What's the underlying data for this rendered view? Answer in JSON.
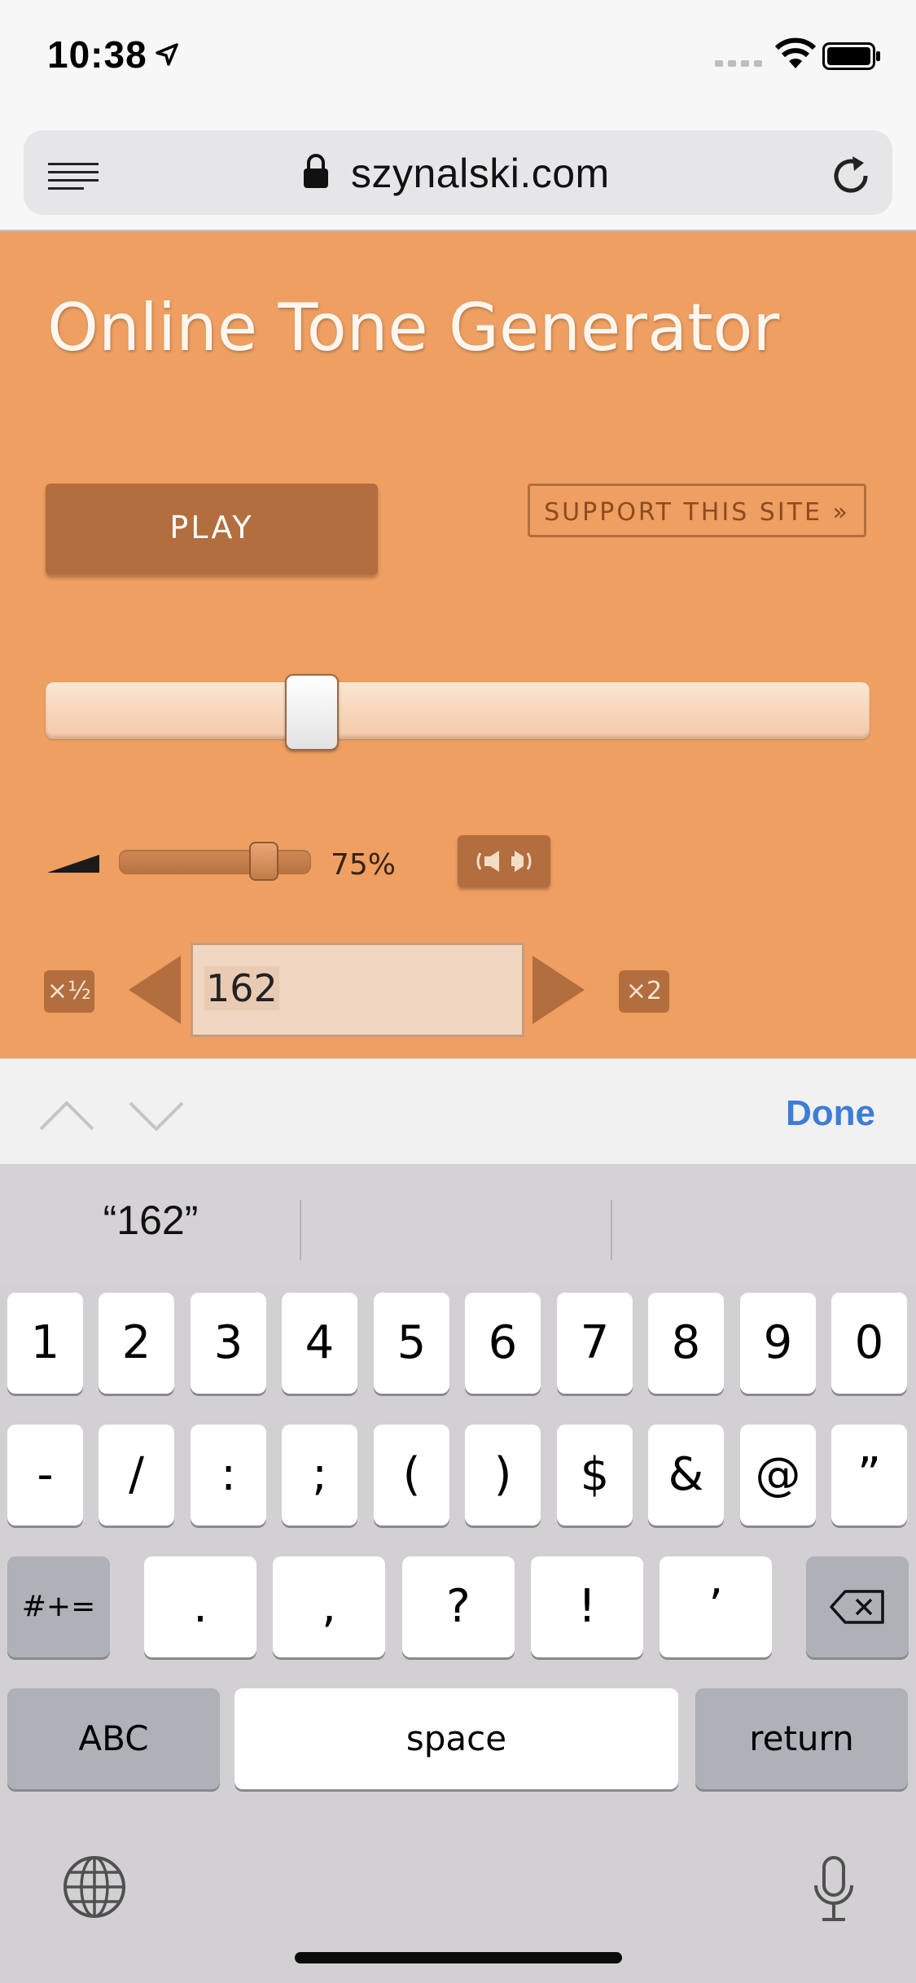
{
  "status_bar": {
    "time": "10:38"
  },
  "browser": {
    "url": "szynalski.com"
  },
  "page": {
    "title": "Online Tone Generator",
    "play_label": "PLAY",
    "support_label": "SUPPORT THIS SITE »",
    "volume_percent": 75,
    "volume_label": "75%",
    "half_label": "×½",
    "double_label": "×2",
    "frequency_value": "162"
  },
  "accessory": {
    "done_label": "Done"
  },
  "suggestions": [
    "“162”",
    "",
    ""
  ],
  "keyboard": {
    "row1": [
      "1",
      "2",
      "3",
      "4",
      "5",
      "6",
      "7",
      "8",
      "9",
      "0"
    ],
    "row2": [
      "-",
      "/",
      ":",
      ";",
      "(",
      ")",
      "$",
      "&",
      "@",
      "”"
    ],
    "row3": [
      "#+=",
      ".",
      ",",
      "?",
      "!",
      "’"
    ],
    "row4": [
      "ABC",
      "space",
      "return"
    ]
  },
  "colors": {
    "page_background": "#ee9f61",
    "accent_brown": "#b26e3e",
    "done_blue": "#3b7dd8"
  }
}
